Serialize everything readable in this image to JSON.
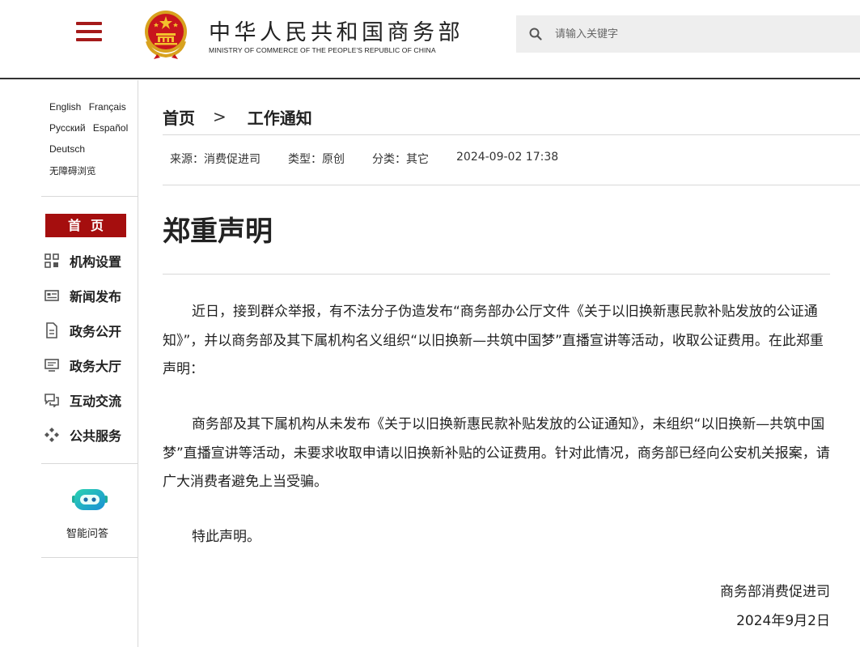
{
  "header": {
    "title": "中华人民共和国商务部",
    "subtitle": "MINISTRY OF COMMERCE OF THE PEOPLE'S REPUBLIC OF CHINA",
    "search_placeholder": "请输入关键字",
    "brand_color": "#a51a1a"
  },
  "sidebar": {
    "languages": [
      "English",
      "Français",
      "Русский",
      "Español",
      "Deutsch"
    ],
    "accessibility": "无障碍浏览",
    "home": "首页",
    "nav_items": [
      {
        "label": "机构设置",
        "icon": "org-grid-icon"
      },
      {
        "label": "新闻发布",
        "icon": "news-icon"
      },
      {
        "label": "政务公开",
        "icon": "document-icon"
      },
      {
        "label": "政务大厅",
        "icon": "monitor-icon"
      },
      {
        "label": "互动交流",
        "icon": "chat-icon"
      },
      {
        "label": "公共服务",
        "icon": "service-icon"
      }
    ],
    "chatbot_label": "智能问答"
  },
  "breadcrumb": {
    "home": "首页",
    "separator": ">",
    "current": "工作通知"
  },
  "meta": {
    "source": "来源：消费促进司",
    "type": "类型：原创",
    "category": "分类：其它",
    "datetime": "2024-09-02 17:38"
  },
  "article": {
    "title": "郑重声明",
    "paragraphs": [
      "近日，接到群众举报，有不法分子伪造发布“商务部办公厅文件《关于以旧换新惠民款补贴发放的公证通知》”，并以商务部及其下属机构名义组织“以旧换新—共筑中国梦”直播宣讲等活动，收取公证费用。在此郑重声明：",
      "商务部及其下属机构从未发布《关于以旧换新惠民款补贴发放的公证通知》，未组织“以旧换新—共筑中国梦”直播宣讲等活动，未要求收取申请以旧换新补贴的公证费用。针对此情况，商务部已经向公安机关报案，请广大消费者避免上当受骗。",
      "特此声明。"
    ],
    "signature_org": "商务部消费促进司",
    "signature_date": "2024年9月2日"
  }
}
